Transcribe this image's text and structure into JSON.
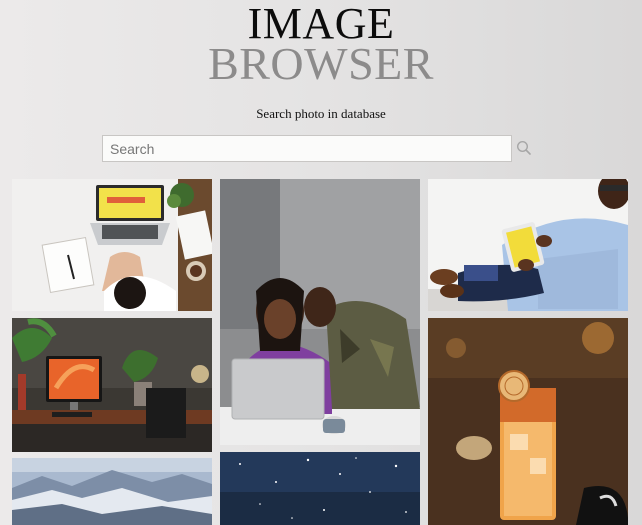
{
  "header": {
    "title_line1": "IMAGE",
    "title_line2": "BROWSER",
    "subtitle": "Search photo in database"
  },
  "search": {
    "placeholder": "Search",
    "icon": "search-icon"
  },
  "gallery": {
    "photos": [
      {
        "subject": "laptop-desk-flatlay"
      },
      {
        "subject": "couple-with-laptop"
      },
      {
        "subject": "man-with-tablet"
      },
      {
        "subject": "orange-desktop-workspace"
      },
      {
        "subject": "iced-cocktail-drink"
      },
      {
        "subject": "snowy-mountains"
      },
      {
        "subject": "starry-night-sky"
      }
    ]
  },
  "colors": {
    "title_dark": "#0c0c0c",
    "title_gray": "#8c8b8b"
  }
}
